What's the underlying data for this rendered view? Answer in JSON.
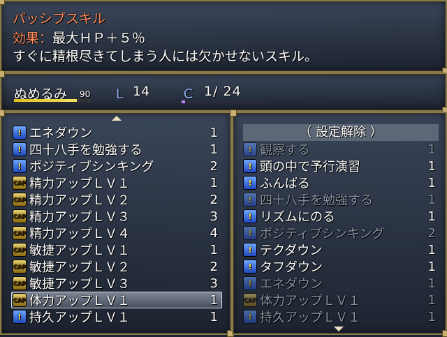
{
  "help": {
    "title": "パッシブスキル",
    "effect_label": "効果：",
    "effect_value": "最大ＨＰ＋５％",
    "description": "すぐに精根尽きてしまう人には欠かせないスキル。"
  },
  "status": {
    "name": "ぬめるみ",
    "hp": "90",
    "hp_fraction": 0.82,
    "level_label": "Ｌ",
    "level": "14",
    "capacity_label": "Ｃ",
    "capacity": "1/ 24",
    "capacity_fraction": 0.04
  },
  "left_list": {
    "items": [
      {
        "label": "エネダウン",
        "value": "1",
        "icon": "blue-skill-icon"
      },
      {
        "label": "四十八手を勉強する",
        "value": "1",
        "icon": "blue-skill-icon"
      },
      {
        "label": "ポジティブシンキング",
        "value": "2",
        "icon": "blue-skill-icon"
      },
      {
        "label": "精力アップＬＶ１",
        "value": "1",
        "icon": "gold-skill-icon"
      },
      {
        "label": "精力アップＬＶ２",
        "value": "2",
        "icon": "gold-skill-icon"
      },
      {
        "label": "精力アップＬＶ３",
        "value": "3",
        "icon": "gold-skill-icon"
      },
      {
        "label": "精力アップＬＶ４",
        "value": "4",
        "icon": "gold-skill-icon"
      },
      {
        "label": "敏捷アップＬＶ１",
        "value": "1",
        "icon": "gold-skill-icon"
      },
      {
        "label": "敏捷アップＬＶ２",
        "value": "2",
        "icon": "gold-skill-icon"
      },
      {
        "label": "敏捷アップＬＶ３",
        "value": "3",
        "icon": "gold-skill-icon"
      },
      {
        "label": "体力アップＬＶ１",
        "value": "1",
        "icon": "gold-skill-icon"
      },
      {
        "label": "持久アップＬＶ１",
        "value": "1",
        "icon": "blue-skill-icon"
      }
    ]
  },
  "right_list": {
    "header": "（ 設定解除 ）",
    "items": [
      {
        "label": "観察する",
        "value": "1",
        "icon": "blue-skill-icon",
        "dim": true
      },
      {
        "label": "頭の中で予行演習",
        "value": "1",
        "icon": "blue-skill-icon",
        "dim": false
      },
      {
        "label": "ふんばる",
        "value": "1",
        "icon": "blue-skill-icon",
        "dim": false
      },
      {
        "label": "四十八手を勉強する",
        "value": "1",
        "icon": "blue-skill-icon",
        "dim": true
      },
      {
        "label": "リズムにのる",
        "value": "1",
        "icon": "blue-skill-icon",
        "dim": false
      },
      {
        "label": "ポジティブシンキング",
        "value": "2",
        "icon": "blue-skill-icon",
        "dim": true
      },
      {
        "label": "テクダウン",
        "value": "1",
        "icon": "blue-skill-icon",
        "dim": false
      },
      {
        "label": "タフダウン",
        "value": "1",
        "icon": "blue-skill-icon",
        "dim": false
      },
      {
        "label": "エネダウン",
        "value": "1",
        "icon": "blue-skill-icon",
        "dim": true
      },
      {
        "label": "体力アップＬＶ１",
        "value": "1",
        "icon": "gold-skill-icon",
        "dim": true
      },
      {
        "label": "持久アップＬＶ１",
        "value": "1",
        "icon": "blue-skill-icon",
        "dim": true
      }
    ]
  }
}
